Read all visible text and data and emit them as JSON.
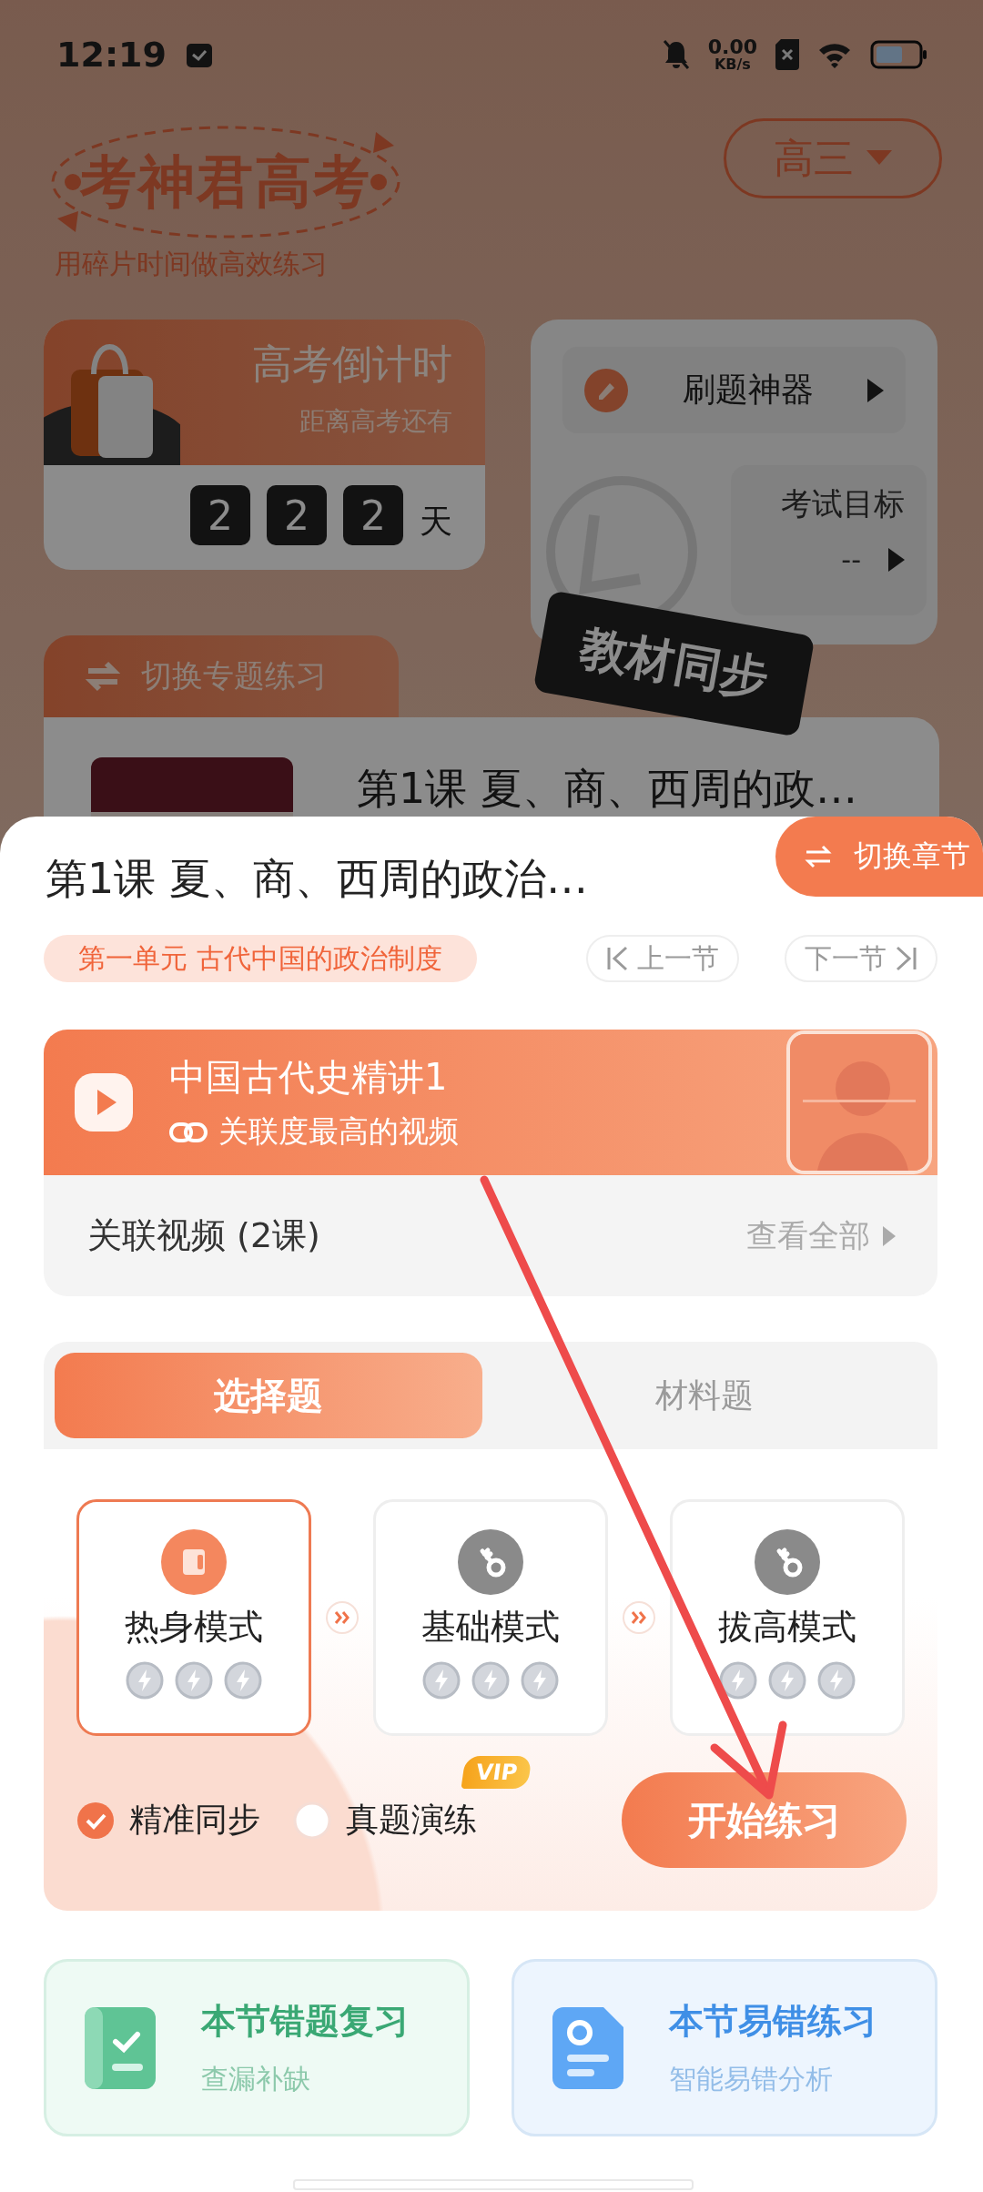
{
  "status_bar": {
    "time": "12:19",
    "net_speed": "0.00",
    "net_unit": "KB/s"
  },
  "header": {
    "logo": "考神君高考",
    "slogan": "用碎片时间做高效练习",
    "grade": "高三"
  },
  "countdown": {
    "title": "高考倒计时",
    "subtitle": "距离高考还有",
    "digits": [
      "2",
      "2",
      "2"
    ],
    "unit": "天"
  },
  "tools": {
    "practice": "刷题神器",
    "goal_label": "考试目标",
    "goal_value": "--"
  },
  "topic": {
    "switch_label": "切换专题练习",
    "tag": "教材同步",
    "lesson_title": "第1课 夏、商、西周的政…"
  },
  "sheet": {
    "switch_chapter": "切换章节",
    "title": "第1课 夏、商、西周的政治…",
    "unit": "第一单元 古代中国的政治制度",
    "prev": "上一节",
    "next": "下一节",
    "video": {
      "title": "中国古代史精讲1",
      "subtitle": "关联度最高的视频",
      "related": "关联视频 (2课)",
      "view_all": "查看全部"
    },
    "tabs": [
      {
        "label": "选择题",
        "selected": true
      },
      {
        "label": "材料题",
        "selected": false
      }
    ],
    "modes": [
      {
        "label": "热身模式",
        "selected": true,
        "locked": false
      },
      {
        "label": "基础模式",
        "selected": false,
        "locked": true
      },
      {
        "label": "拔高模式",
        "selected": false,
        "locked": true
      }
    ],
    "options": [
      {
        "label": "精准同步",
        "checked": true
      },
      {
        "label": "真题演练",
        "checked": false,
        "badge": "VIP"
      }
    ],
    "start": "开始练习",
    "shortcuts": [
      {
        "kind": "review",
        "title": "本节错题复习",
        "subtitle": "查漏补缺"
      },
      {
        "kind": "mistakes",
        "title": "本节易错练习",
        "subtitle": "智能易错分析"
      }
    ]
  }
}
